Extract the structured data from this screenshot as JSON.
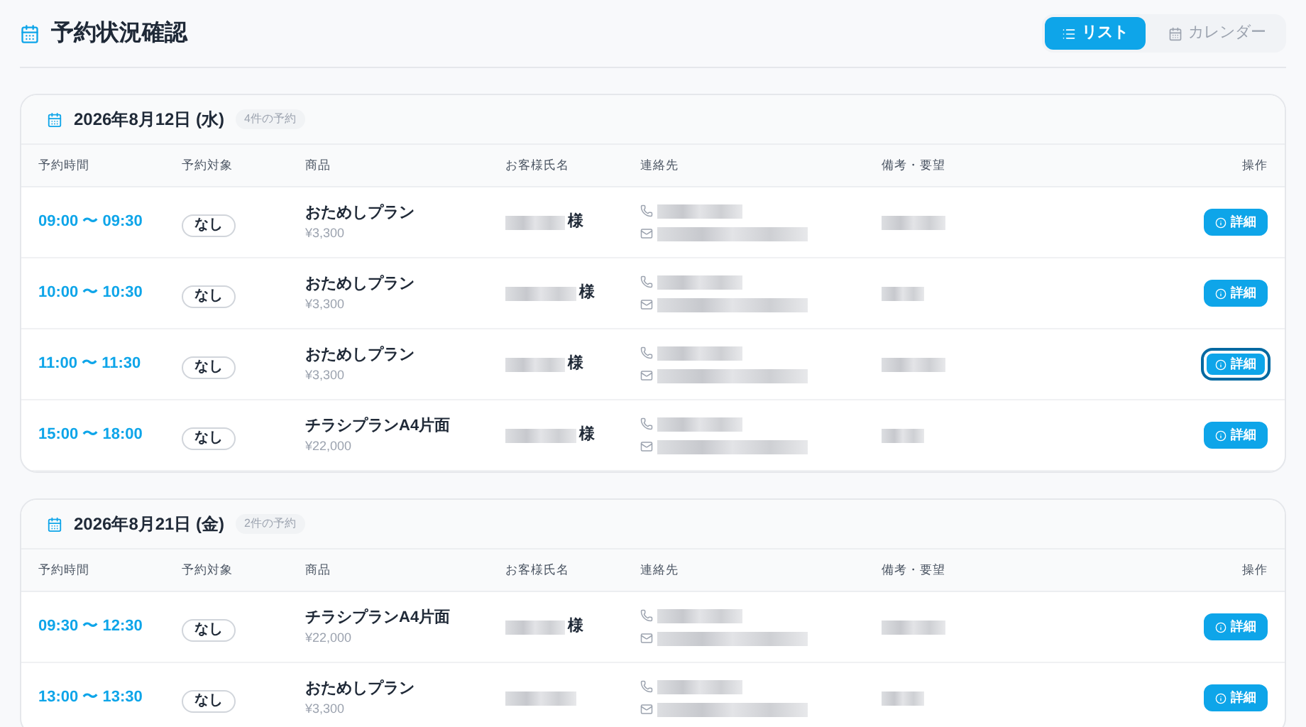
{
  "page": {
    "title": "予約状況確認"
  },
  "view_toggle": [
    {
      "label": "リスト",
      "kind": "list",
      "selected": true
    },
    {
      "label": "カレンダー",
      "kind": "calendar",
      "selected": false
    }
  ],
  "days": [
    {
      "date": "2026年8月12日 (水)",
      "count": "4件の予約",
      "columns": [
        "予約時間",
        "予約対象",
        "商品",
        "お客様氏名",
        "連絡先",
        "備考・要望",
        "操作"
      ],
      "rows": [
        {
          "time": "09:00 〜 09:30",
          "target": "なし",
          "product": "おためしプラン",
          "price": "¥3,300",
          "honorific": "様",
          "action": "詳細",
          "focused": false
        },
        {
          "time": "10:00 〜 10:30",
          "target": "なし",
          "product": "おためしプラン",
          "price": "¥3,300",
          "honorific": "様",
          "action": "詳細",
          "focused": false
        },
        {
          "time": "11:00 〜 11:30",
          "target": "なし",
          "product": "おためしプラン",
          "price": "¥3,300",
          "honorific": "様",
          "action": "詳細",
          "focused": true
        },
        {
          "time": "15:00 〜 18:00",
          "target": "なし",
          "product": "チラシプランA4片面",
          "price": "¥22,000",
          "honorific": "様",
          "action": "詳細",
          "focused": false
        }
      ]
    },
    {
      "date": "2026年8月21日 (金)",
      "count": "2件の予約",
      "columns": [
        "予約時間",
        "予約対象",
        "商品",
        "お客様氏名",
        "連絡先",
        "備考・要望",
        "操作"
      ],
      "rows": [
        {
          "time": "09:30 〜 12:30",
          "target": "なし",
          "product": "チラシプランA4片面",
          "price": "¥22,000",
          "honorific": "様",
          "action": "詳細",
          "focused": false
        },
        {
          "time": "13:00 〜 13:30",
          "target": "なし",
          "product": "おためしプラン",
          "price": "¥3,300",
          "action": "詳細",
          "focused": false
        }
      ]
    }
  ]
}
